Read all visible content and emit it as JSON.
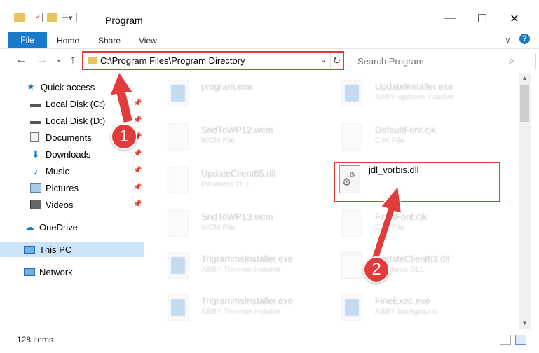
{
  "window": {
    "title": "Program",
    "controls": {
      "minimize": "—",
      "maximize": "☐",
      "close": "✕"
    }
  },
  "ribbon": {
    "file": "File",
    "tabs": [
      "Home",
      "Share",
      "View"
    ],
    "expand": "∨",
    "help": "?"
  },
  "nav": {
    "back": "←",
    "forward": "→",
    "recent": "⌄",
    "up": "↑",
    "address": "C:\\Program Files\\Program Directory",
    "address_dropdown": "⌄",
    "refresh": "↻",
    "search_placeholder": "Search Program",
    "search_icon": "⌕"
  },
  "sidebar": {
    "items": [
      {
        "label": "Quick access",
        "icon": "star-icon",
        "pinned": false
      },
      {
        "label": "Local Disk (C:)",
        "icon": "drive-icon",
        "pinned": true
      },
      {
        "label": "Local Disk (D:)",
        "icon": "drive-icon",
        "pinned": true
      },
      {
        "label": "Documents",
        "icon": "documents-icon",
        "pinned": true
      },
      {
        "label": "Downloads",
        "icon": "downloads-icon",
        "pinned": true
      },
      {
        "label": "Music",
        "icon": "music-icon",
        "pinned": true
      },
      {
        "label": "Pictures",
        "icon": "pictures-icon",
        "pinned": true
      },
      {
        "label": "Videos",
        "icon": "videos-icon",
        "pinned": true
      },
      {
        "label": "OneDrive",
        "icon": "cloud-icon",
        "pinned": false
      },
      {
        "label": "This PC",
        "icon": "computer-icon",
        "pinned": false,
        "selected": true
      },
      {
        "label": "Network",
        "icon": "network-icon",
        "pinned": false
      }
    ]
  },
  "files": [
    {
      "name": "program.exe",
      "sub": "",
      "kind": "exe"
    },
    {
      "name": "UpdateInstaller.exe",
      "sub": "ABBY updates installer",
      "kind": "exe"
    },
    {
      "name": "SndToWP12.wcm",
      "sub": "WCM File",
      "kind": "doc"
    },
    {
      "name": "DefaultFont.cjk",
      "sub": "CJK File",
      "kind": "doc"
    },
    {
      "name": "UpdateClient65.dll",
      "sub": "Resource DLL",
      "kind": "gear"
    },
    {
      "name": "SndToWP13.wcm",
      "sub": "WCM File",
      "kind": "doc"
    },
    {
      "name": "FaultFont.cjk",
      "sub": "CJK File",
      "kind": "doc"
    },
    {
      "name": "TrigrammsInstaller.exe",
      "sub": "ABBY Trimmer installer",
      "kind": "exe"
    },
    {
      "name": "UpdateClient63.dll",
      "sub": "Resource DLL",
      "kind": "gear"
    },
    {
      "name": "TrigrammsInstaller.exe",
      "sub": "ABBY Trimmer installer",
      "kind": "exe"
    },
    {
      "name": "FineExec.exe",
      "sub": "ABBY background",
      "kind": "exe"
    }
  ],
  "highlighted_file": {
    "name": "jdl_vorbis.dll"
  },
  "status": {
    "count": "128 items"
  },
  "annotations": {
    "step1": "1",
    "step2": "2"
  },
  "colors": {
    "accent": "#1979ca",
    "highlight": "#e03a3a",
    "selected": "#cce4f7"
  }
}
